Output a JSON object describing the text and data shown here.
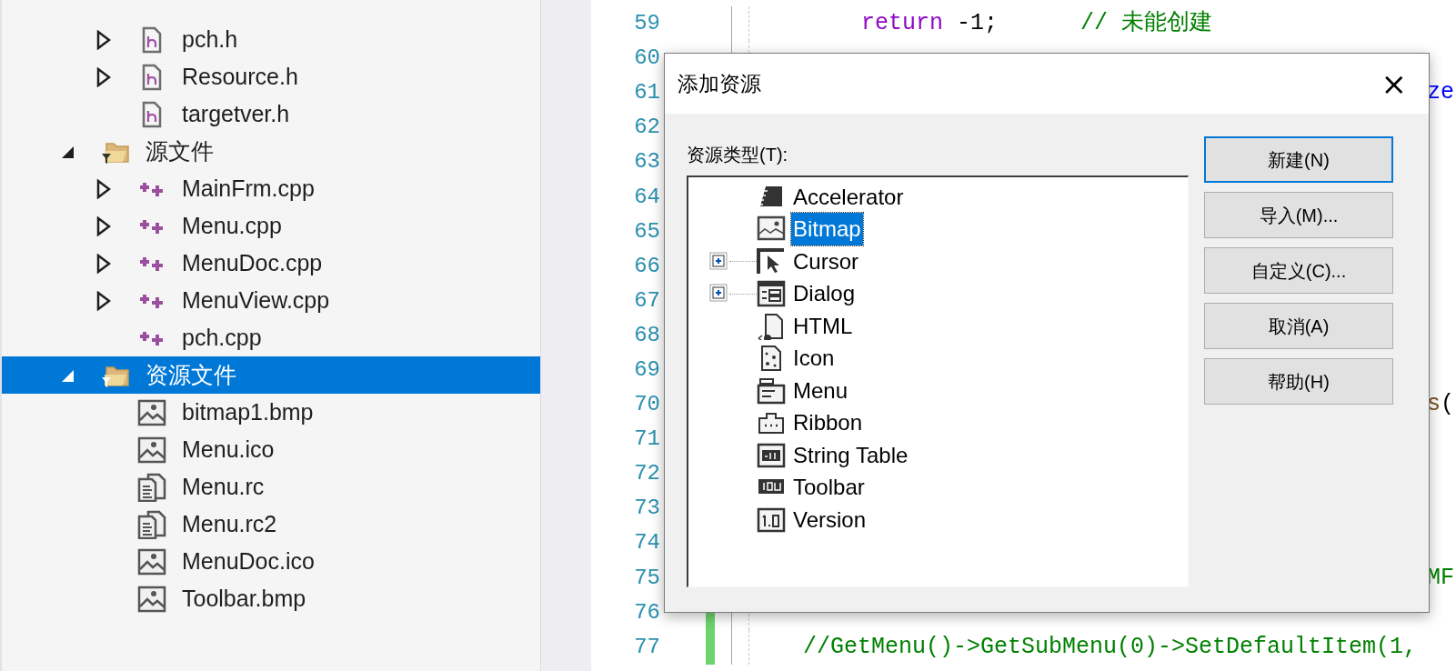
{
  "solution_tree": {
    "scrolled_folder_children": [
      {
        "label": "pch.h",
        "kind": "header",
        "expandable": true,
        "selected": false
      },
      {
        "label": "Resource.h",
        "kind": "header",
        "expandable": true,
        "selected": false
      },
      {
        "label": "targetver.h",
        "kind": "header",
        "expandable": false,
        "selected": false
      }
    ],
    "folders": [
      {
        "label": "源文件",
        "expanded": true,
        "selected": false,
        "children": [
          {
            "label": "MainFrm.cpp",
            "kind": "cpp",
            "expandable": true,
            "selected": false
          },
          {
            "label": "Menu.cpp",
            "kind": "cpp",
            "expandable": true,
            "selected": false
          },
          {
            "label": "MenuDoc.cpp",
            "kind": "cpp",
            "expandable": true,
            "selected": false
          },
          {
            "label": "MenuView.cpp",
            "kind": "cpp",
            "expandable": true,
            "selected": false
          },
          {
            "label": "pch.cpp",
            "kind": "cpp",
            "expandable": false,
            "selected": false
          }
        ]
      },
      {
        "label": "资源文件",
        "expanded": true,
        "selected": true,
        "children": [
          {
            "label": "bitmap1.bmp",
            "kind": "image",
            "expandable": false,
            "selected": false
          },
          {
            "label": "Menu.ico",
            "kind": "image",
            "expandable": false,
            "selected": false
          },
          {
            "label": "Menu.rc",
            "kind": "rc",
            "expandable": false,
            "selected": false
          },
          {
            "label": "Menu.rc2",
            "kind": "rc",
            "expandable": false,
            "selected": false
          },
          {
            "label": "MenuDoc.ico",
            "kind": "image",
            "expandable": false,
            "selected": false
          },
          {
            "label": "Toolbar.bmp",
            "kind": "image",
            "expandable": false,
            "selected": false
          }
        ]
      }
    ]
  },
  "editor": {
    "lines": [
      {
        "number": "59",
        "modified": false,
        "code": [
          {
            "text": "return",
            "kind": "keyword"
          },
          {
            "text": "-1;",
            "kind": "plain"
          },
          {
            "text": "// 未能创建",
            "kind": "comment"
          }
        ]
      },
      {
        "number": "60"
      },
      {
        "number": "61",
        "tail": [
          {
            "text": "ze",
            "kind": "type"
          }
        ]
      },
      {
        "number": "62"
      },
      {
        "number": "63"
      },
      {
        "number": "64"
      },
      {
        "number": "65"
      },
      {
        "number": "66"
      },
      {
        "number": "67"
      },
      {
        "number": "68"
      },
      {
        "number": "69"
      },
      {
        "number": "70",
        "tail": [
          {
            "text": "s",
            "kind": "function"
          },
          {
            "text": "(",
            "kind": "plain"
          }
        ]
      },
      {
        "number": "71"
      },
      {
        "number": "72"
      },
      {
        "number": "73"
      },
      {
        "number": "74"
      },
      {
        "number": "75",
        "tail": [
          {
            "text": "MF",
            "kind": "comment"
          }
        ]
      },
      {
        "number": "76",
        "modified": true
      },
      {
        "number": "77",
        "modified": true,
        "code": [
          {
            "text": "//GetMenu()->GetSubMenu(0)->SetDefaultItem(1,",
            "kind": "comment"
          }
        ]
      }
    ]
  },
  "dialog": {
    "title": "添加资源",
    "close": "×",
    "list_label": "资源类型(T):",
    "resource_types": [
      {
        "label": "Accelerator",
        "kind": "accelerator",
        "has_children": false,
        "selected": false
      },
      {
        "label": "Bitmap",
        "kind": "bitmap",
        "has_children": false,
        "selected": true
      },
      {
        "label": "Cursor",
        "kind": "cursor",
        "has_children": true,
        "selected": false
      },
      {
        "label": "Dialog",
        "kind": "dialog",
        "has_children": true,
        "selected": false
      },
      {
        "label": "HTML",
        "kind": "html",
        "has_children": false,
        "selected": false
      },
      {
        "label": "Icon",
        "kind": "icon",
        "has_children": false,
        "selected": false
      },
      {
        "label": "Menu",
        "kind": "menu",
        "has_children": false,
        "selected": false
      },
      {
        "label": "Ribbon",
        "kind": "ribbon",
        "has_children": false,
        "selected": false
      },
      {
        "label": "String Table",
        "kind": "string_table",
        "has_children": false,
        "selected": false
      },
      {
        "label": "Toolbar",
        "kind": "toolbar",
        "has_children": false,
        "selected": false
      },
      {
        "label": "Version",
        "kind": "version",
        "has_children": false,
        "selected": false
      }
    ],
    "buttons": [
      {
        "label": "新建(N)",
        "default": true
      },
      {
        "label": "导入(M)...",
        "default": false
      },
      {
        "label": "自定义(C)...",
        "default": false
      },
      {
        "label": "取消(A)",
        "default": false
      },
      {
        "label": "帮助(H)",
        "default": false
      }
    ]
  }
}
